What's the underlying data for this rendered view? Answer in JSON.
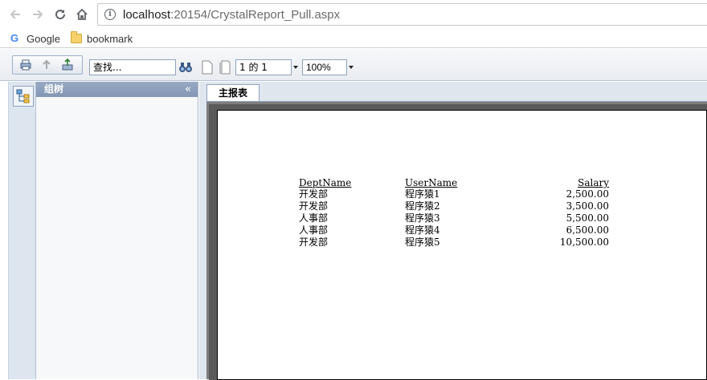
{
  "browser": {
    "url_host": "localhost",
    "url_path": ":20154/CrystalReport_Pull.aspx",
    "bookmarks": [
      {
        "label": "Google",
        "icon": "google-icon"
      },
      {
        "label": "bookmark",
        "icon": "folder-icon"
      }
    ]
  },
  "toolbar": {
    "search_value": "查找...",
    "page_value": "1 的 1",
    "zoom_value": "100%"
  },
  "tree_panel": {
    "title": "组树",
    "collapse_label": "«"
  },
  "tabs": [
    {
      "label": "主报表",
      "active": true
    }
  ],
  "report": {
    "columns": [
      "DeptName",
      "UserName",
      "Salary"
    ],
    "rows": [
      [
        "开发部",
        "程序猿1",
        "2,500.00"
      ],
      [
        "开发部",
        "程序猿2",
        "3,500.00"
      ],
      [
        "人事部",
        "程序猿3",
        "5,500.00"
      ],
      [
        "人事部",
        "程序猿4",
        "6,500.00"
      ],
      [
        "开发部",
        "程序猿5",
        "10,500.00"
      ]
    ]
  },
  "colors": {
    "tree_header": "#8a9cb9",
    "panel_border": "#8fa3be",
    "viewer_bg": "#dfe6ee"
  }
}
